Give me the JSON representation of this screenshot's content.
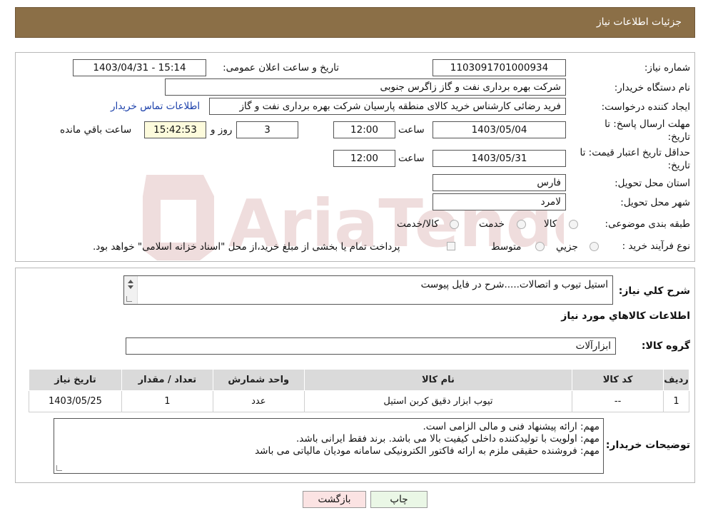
{
  "header": {
    "title": "جزئیات اطلاعات نیاز"
  },
  "form": {
    "need_number_label": "شماره نیاز:",
    "need_number": "1103091701000934",
    "announce_label": "تاریخ و ساعت اعلان عمومی:",
    "announce_value": "1403/04/31 - 15:14",
    "buyer_org_label": "نام دستگاه خریدار:",
    "buyer_org": "شرکت بهره برداری نفت و گاز زاگرس جنوبی",
    "creator_label": "ایجاد کننده درخواست:",
    "creator": "فرید رضائی کارشناس خرید کالای منطقه پارسیان شرکت بهره برداری نفت و گاز",
    "contact_link": "اطلاعات تماس خریدار",
    "deadline_label_1": "مهلت ارسال پاسخ: تا",
    "deadline_label_2": "تاریخ:",
    "deadline_date": "1403/05/04",
    "time_label": "ساعت",
    "deadline_time": "12:00",
    "days_value": "3",
    "days_label": "روز و",
    "remaining_time": "15:42:53",
    "remaining_label": "ساعت باقي مانده",
    "validity_label_1": "حداقل تاریخ اعتبار قیمت: تا",
    "validity_label_2": "تاریخ:",
    "validity_date": "1403/05/31",
    "validity_time": "12:00",
    "province_label": "استان محل تحویل:",
    "province": "فارس",
    "city_label": "شهر محل تحویل:",
    "city": "لامرد",
    "category_label": "طبقه بندی موضوعی:",
    "category_options": [
      "کالا",
      "خدمت",
      "کالا/خدمت"
    ],
    "process_label": "نوع فرآیند خرید :",
    "process_options": [
      "جزيي",
      "متوسط"
    ],
    "process_note": "پرداخت تمام یا بخشی از مبلغ خرید،از محل \"اسناد خزانه اسلامی\" خواهد بود."
  },
  "details": {
    "description_label": "شرح کلي نياز:",
    "description": "استیل تیوب و اتصالات.....شرح در فایل پیوست",
    "items_title": "اطلاعات کالاهاي مورد نياز",
    "group_label": "گروه کالا:",
    "group_value": "ابزارآلات",
    "table": {
      "headers": [
        "رديف",
        "کد کالا",
        "نام کالا",
        "واحد شمارش",
        "تعداد / مقدار",
        "تاریخ نیاز"
      ],
      "rows": [
        [
          "1",
          "--",
          "تیوب ابزار دقیق کربن استیل",
          "عدد",
          "1",
          "1403/05/25"
        ]
      ]
    },
    "buyer_notes_label": "توضیحات خریدار:",
    "buyer_notes": [
      "مهم: ارائه پیشنهاد فنی و مالی الزامی است.",
      "مهم: اولویت با تولیدکننده داخلی کیفیت بالا می باشد. برند فقط ایرانی باشد.",
      "مهم: فروشنده حقیقی ملزم به ارائه فاکتور الکترونیکی سامانه مودیان مالیاتی می باشد"
    ]
  },
  "buttons": {
    "print": "چاپ",
    "back": "بازگشت"
  },
  "watermark_text": "AriaTender.neT",
  "colors": {
    "header": "#8b6f47",
    "print_bg": "#eaf7e6",
    "back_bg": "#fbe3e3",
    "remaining_bg": "#fdfbdc",
    "link": "#1a3faa"
  }
}
